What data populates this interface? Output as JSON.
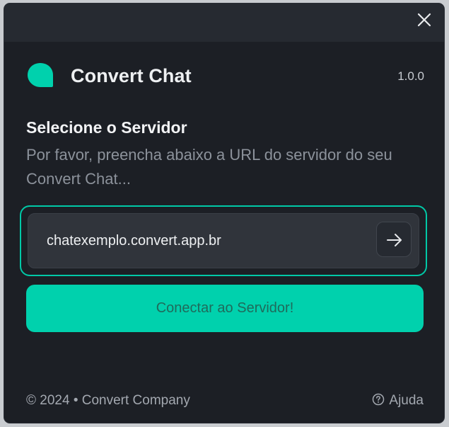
{
  "app": {
    "name": "Convert Chat",
    "version": "1.0.0"
  },
  "server": {
    "title": "Selecione o Servidor",
    "description": "Por favor, preencha abaixo a URL do servidor do seu Convert Chat...",
    "url_value": "chatexemplo.convert.app.br",
    "connect_label": "Conectar ao Servidor!"
  },
  "footer": {
    "copyright": "© 2024 • Convert Company",
    "help_label": "Ajuda"
  },
  "icons": {
    "close": "close-icon",
    "logo": "chat-bubble-icon",
    "submit": "arrow-right-icon",
    "help": "question-circle-icon"
  },
  "colors": {
    "accent": "#00d1ad",
    "background": "#1c1f25",
    "titlebar": "#262a31"
  }
}
